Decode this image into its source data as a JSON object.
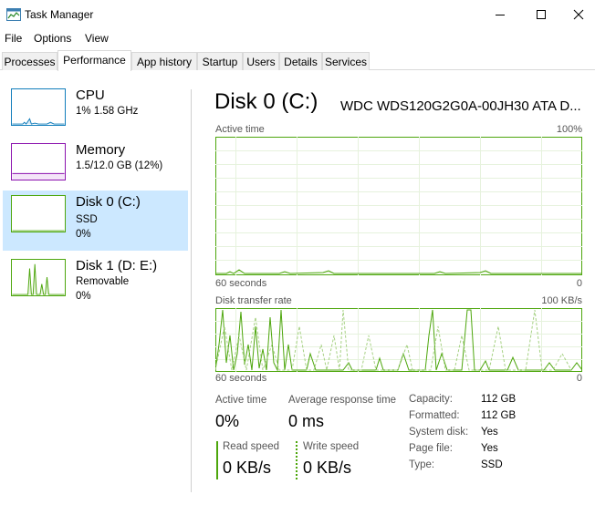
{
  "window": {
    "title": "Task Manager"
  },
  "menu": [
    "File",
    "Options",
    "View"
  ],
  "tabs": [
    {
      "label": "Processes",
      "active": false
    },
    {
      "label": "Performance",
      "active": true
    },
    {
      "label": "App history",
      "active": false
    },
    {
      "label": "Startup",
      "active": false
    },
    {
      "label": "Users",
      "active": false
    },
    {
      "label": "Details",
      "active": false
    },
    {
      "label": "Services",
      "active": false
    }
  ],
  "sidebar": {
    "items": [
      {
        "title": "CPU",
        "line1": "1%  1.58 GHz",
        "line2": ""
      },
      {
        "title": "Memory",
        "line1": "1.5/12.0 GB (12%)",
        "line2": ""
      },
      {
        "title": "Disk 0 (C:)",
        "line1": "SSD",
        "line2": "0%"
      },
      {
        "title": "Disk 1 (D: E:)",
        "line1": "Removable",
        "line2": "0%"
      }
    ],
    "selected_index": 2
  },
  "main": {
    "heading": "Disk 0 (C:)",
    "model": "WDC WDS120G2G0A-00JH30 ATA D...",
    "active_time_graph": {
      "label": "Active time",
      "max_label": "100%",
      "time_label": "60 seconds",
      "min_label": "0"
    },
    "transfer_graph": {
      "label": "Disk transfer rate",
      "max_label": "100 KB/s",
      "time_label": "60 seconds",
      "min_label": "0"
    },
    "stats": {
      "active_time_label": "Active time",
      "active_time_value": "0%",
      "avg_response_label": "Average response time",
      "avg_response_value": "0 ms",
      "read_speed_label": "Read speed",
      "read_speed_value": "0 KB/s",
      "write_speed_label": "Write speed",
      "write_speed_value": "0 KB/s"
    },
    "info": [
      {
        "label": "Capacity:",
        "value": "112 GB"
      },
      {
        "label": "Formatted:",
        "value": "112 GB"
      },
      {
        "label": "System disk:",
        "value": "Yes"
      },
      {
        "label": "Page file:",
        "value": "Yes"
      },
      {
        "label": "Type:",
        "value": "SSD"
      }
    ]
  },
  "colors": {
    "cpu": "#117dbb",
    "memory": "#8b12ae",
    "disk": "#4da60c",
    "selected_bg": "#cce8ff"
  }
}
